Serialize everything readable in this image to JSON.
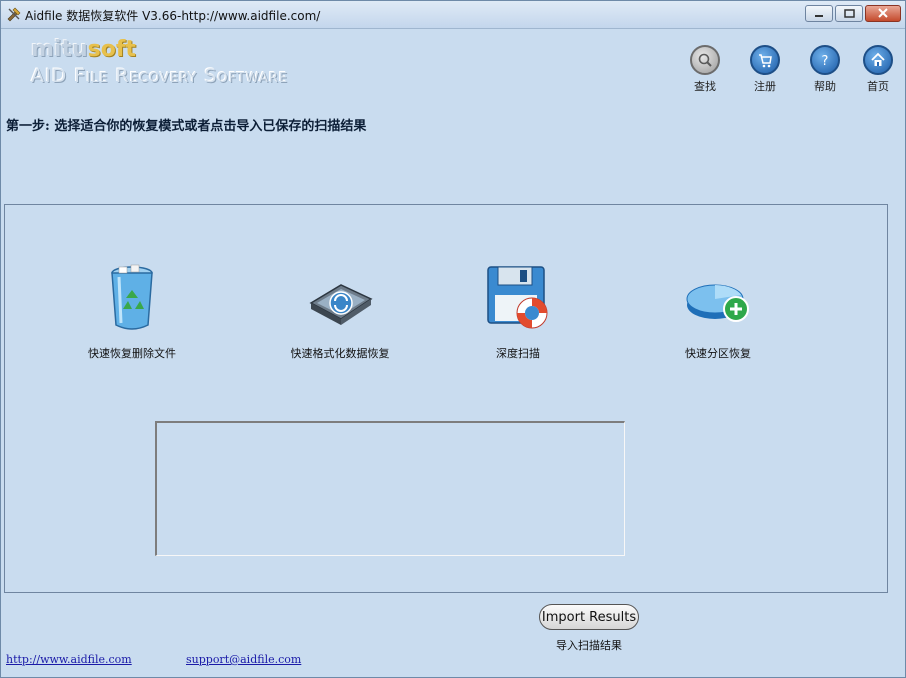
{
  "window": {
    "title": "Aidfile 数据恢复软件 V3.66-http://www.aidfile.com/"
  },
  "logo": {
    "brand_main": "mitu",
    "brand_accent": "soft",
    "subtitle": "AID File Recovery Software"
  },
  "nav": {
    "items": [
      {
        "label": "查找",
        "icon": "search-icon"
      },
      {
        "label": "注册",
        "icon": "cart-icon"
      },
      {
        "label": "帮助",
        "icon": "help-icon"
      },
      {
        "label": "首页",
        "icon": "home-icon"
      }
    ]
  },
  "step": {
    "text": "第一步: 选择适合你的恢复模式或者点击导入已保存的扫描结果"
  },
  "modes": [
    {
      "label": "快速恢复删除文件",
      "icon": "recycle-bin-icon"
    },
    {
      "label": "快速格式化数据恢复",
      "icon": "drive-refresh-icon"
    },
    {
      "label": "深度扫描",
      "icon": "floppy-lifebuoy-icon"
    },
    {
      "label": "快速分区恢复",
      "icon": "partition-add-icon"
    }
  ],
  "import": {
    "button_label": "Import  Results",
    "caption": "导入扫描结果"
  },
  "footer": {
    "website": "http://www.aidfile.com",
    "email": "support@aidfile.com"
  },
  "colors": {
    "background": "#c9dcef",
    "nav_blue": "#1e5ea8",
    "link": "#1a1aa8"
  }
}
